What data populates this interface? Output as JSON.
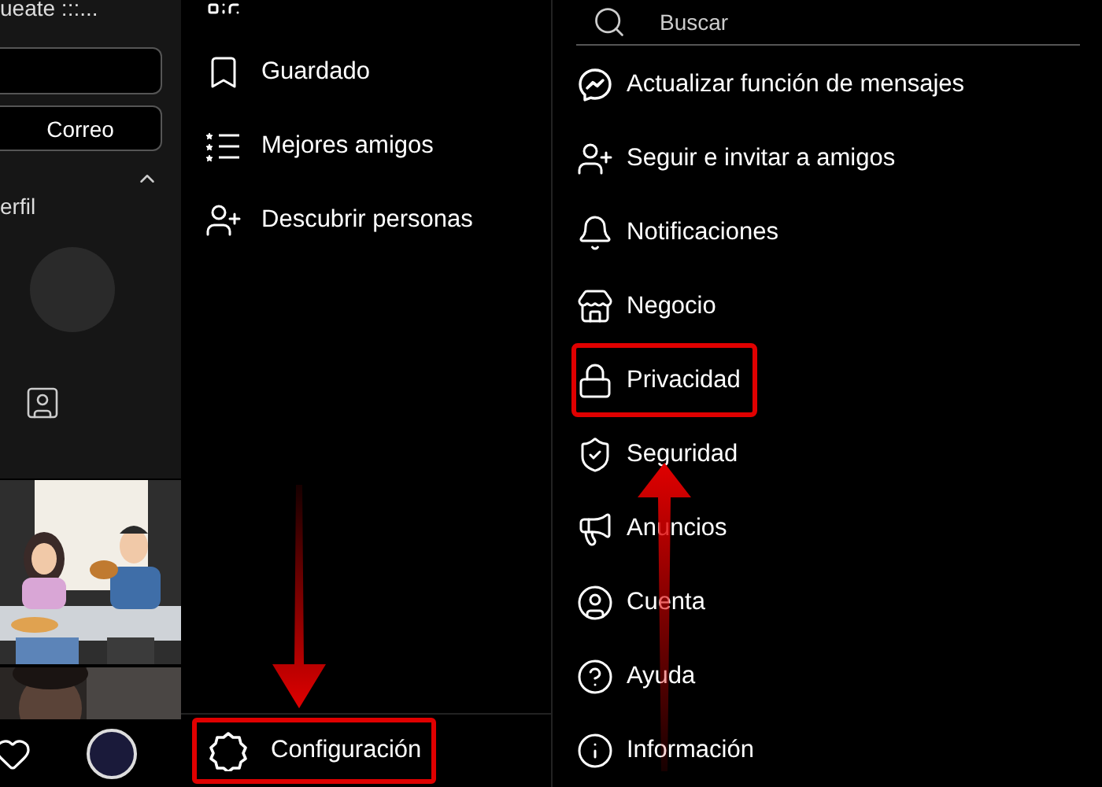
{
  "profile_panel": {
    "header_text": "ueate :::...",
    "button": "Correo",
    "section": {
      "label": "erfil",
      "expanded": true
    }
  },
  "side_menu": {
    "items": [
      {
        "label": "Guardado"
      },
      {
        "label": "Mejores amigos"
      },
      {
        "label": "Descubrir personas"
      }
    ],
    "footer": {
      "label": "Configuración",
      "highlighted": true
    }
  },
  "settings": {
    "search": {
      "placeholder": "Buscar"
    },
    "items": [
      {
        "label": "Actualizar función de mensajes",
        "highlighted": false
      },
      {
        "label": "Seguir e invitar a amigos",
        "highlighted": false
      },
      {
        "label": "Notificaciones",
        "highlighted": false
      },
      {
        "label": "Negocio",
        "highlighted": false
      },
      {
        "label": "Privacidad",
        "highlighted": true
      },
      {
        "label": "Seguridad",
        "highlighted": false
      },
      {
        "label": "Anuncios",
        "highlighted": false
      },
      {
        "label": "Cuenta",
        "highlighted": false
      },
      {
        "label": "Ayuda",
        "highlighted": false
      },
      {
        "label": "Información",
        "highlighted": false
      }
    ]
  }
}
